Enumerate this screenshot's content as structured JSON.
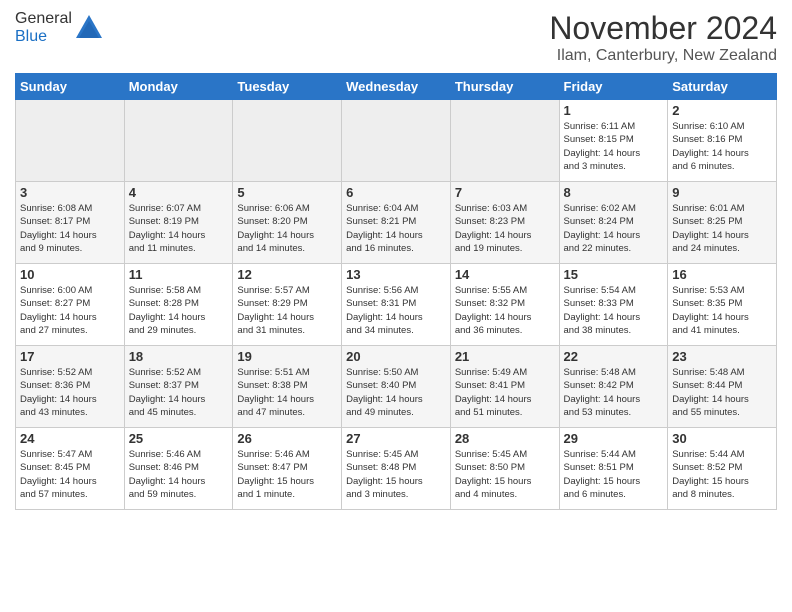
{
  "header": {
    "logo_general": "General",
    "logo_blue": "Blue",
    "month_title": "November 2024",
    "location": "Ilam, Canterbury, New Zealand"
  },
  "weekdays": [
    "Sunday",
    "Monday",
    "Tuesday",
    "Wednesday",
    "Thursday",
    "Friday",
    "Saturday"
  ],
  "weeks": [
    [
      {
        "day": "",
        "info": ""
      },
      {
        "day": "",
        "info": ""
      },
      {
        "day": "",
        "info": ""
      },
      {
        "day": "",
        "info": ""
      },
      {
        "day": "",
        "info": ""
      },
      {
        "day": "1",
        "info": "Sunrise: 6:11 AM\nSunset: 8:15 PM\nDaylight: 14 hours\nand 3 minutes."
      },
      {
        "day": "2",
        "info": "Sunrise: 6:10 AM\nSunset: 8:16 PM\nDaylight: 14 hours\nand 6 minutes."
      }
    ],
    [
      {
        "day": "3",
        "info": "Sunrise: 6:08 AM\nSunset: 8:17 PM\nDaylight: 14 hours\nand 9 minutes."
      },
      {
        "day": "4",
        "info": "Sunrise: 6:07 AM\nSunset: 8:19 PM\nDaylight: 14 hours\nand 11 minutes."
      },
      {
        "day": "5",
        "info": "Sunrise: 6:06 AM\nSunset: 8:20 PM\nDaylight: 14 hours\nand 14 minutes."
      },
      {
        "day": "6",
        "info": "Sunrise: 6:04 AM\nSunset: 8:21 PM\nDaylight: 14 hours\nand 16 minutes."
      },
      {
        "day": "7",
        "info": "Sunrise: 6:03 AM\nSunset: 8:23 PM\nDaylight: 14 hours\nand 19 minutes."
      },
      {
        "day": "8",
        "info": "Sunrise: 6:02 AM\nSunset: 8:24 PM\nDaylight: 14 hours\nand 22 minutes."
      },
      {
        "day": "9",
        "info": "Sunrise: 6:01 AM\nSunset: 8:25 PM\nDaylight: 14 hours\nand 24 minutes."
      }
    ],
    [
      {
        "day": "10",
        "info": "Sunrise: 6:00 AM\nSunset: 8:27 PM\nDaylight: 14 hours\nand 27 minutes."
      },
      {
        "day": "11",
        "info": "Sunrise: 5:58 AM\nSunset: 8:28 PM\nDaylight: 14 hours\nand 29 minutes."
      },
      {
        "day": "12",
        "info": "Sunrise: 5:57 AM\nSunset: 8:29 PM\nDaylight: 14 hours\nand 31 minutes."
      },
      {
        "day": "13",
        "info": "Sunrise: 5:56 AM\nSunset: 8:31 PM\nDaylight: 14 hours\nand 34 minutes."
      },
      {
        "day": "14",
        "info": "Sunrise: 5:55 AM\nSunset: 8:32 PM\nDaylight: 14 hours\nand 36 minutes."
      },
      {
        "day": "15",
        "info": "Sunrise: 5:54 AM\nSunset: 8:33 PM\nDaylight: 14 hours\nand 38 minutes."
      },
      {
        "day": "16",
        "info": "Sunrise: 5:53 AM\nSunset: 8:35 PM\nDaylight: 14 hours\nand 41 minutes."
      }
    ],
    [
      {
        "day": "17",
        "info": "Sunrise: 5:52 AM\nSunset: 8:36 PM\nDaylight: 14 hours\nand 43 minutes."
      },
      {
        "day": "18",
        "info": "Sunrise: 5:52 AM\nSunset: 8:37 PM\nDaylight: 14 hours\nand 45 minutes."
      },
      {
        "day": "19",
        "info": "Sunrise: 5:51 AM\nSunset: 8:38 PM\nDaylight: 14 hours\nand 47 minutes."
      },
      {
        "day": "20",
        "info": "Sunrise: 5:50 AM\nSunset: 8:40 PM\nDaylight: 14 hours\nand 49 minutes."
      },
      {
        "day": "21",
        "info": "Sunrise: 5:49 AM\nSunset: 8:41 PM\nDaylight: 14 hours\nand 51 minutes."
      },
      {
        "day": "22",
        "info": "Sunrise: 5:48 AM\nSunset: 8:42 PM\nDaylight: 14 hours\nand 53 minutes."
      },
      {
        "day": "23",
        "info": "Sunrise: 5:48 AM\nSunset: 8:44 PM\nDaylight: 14 hours\nand 55 minutes."
      }
    ],
    [
      {
        "day": "24",
        "info": "Sunrise: 5:47 AM\nSunset: 8:45 PM\nDaylight: 14 hours\nand 57 minutes."
      },
      {
        "day": "25",
        "info": "Sunrise: 5:46 AM\nSunset: 8:46 PM\nDaylight: 14 hours\nand 59 minutes."
      },
      {
        "day": "26",
        "info": "Sunrise: 5:46 AM\nSunset: 8:47 PM\nDaylight: 15 hours\nand 1 minute."
      },
      {
        "day": "27",
        "info": "Sunrise: 5:45 AM\nSunset: 8:48 PM\nDaylight: 15 hours\nand 3 minutes."
      },
      {
        "day": "28",
        "info": "Sunrise: 5:45 AM\nSunset: 8:50 PM\nDaylight: 15 hours\nand 4 minutes."
      },
      {
        "day": "29",
        "info": "Sunrise: 5:44 AM\nSunset: 8:51 PM\nDaylight: 15 hours\nand 6 minutes."
      },
      {
        "day": "30",
        "info": "Sunrise: 5:44 AM\nSunset: 8:52 PM\nDaylight: 15 hours\nand 8 minutes."
      }
    ]
  ]
}
